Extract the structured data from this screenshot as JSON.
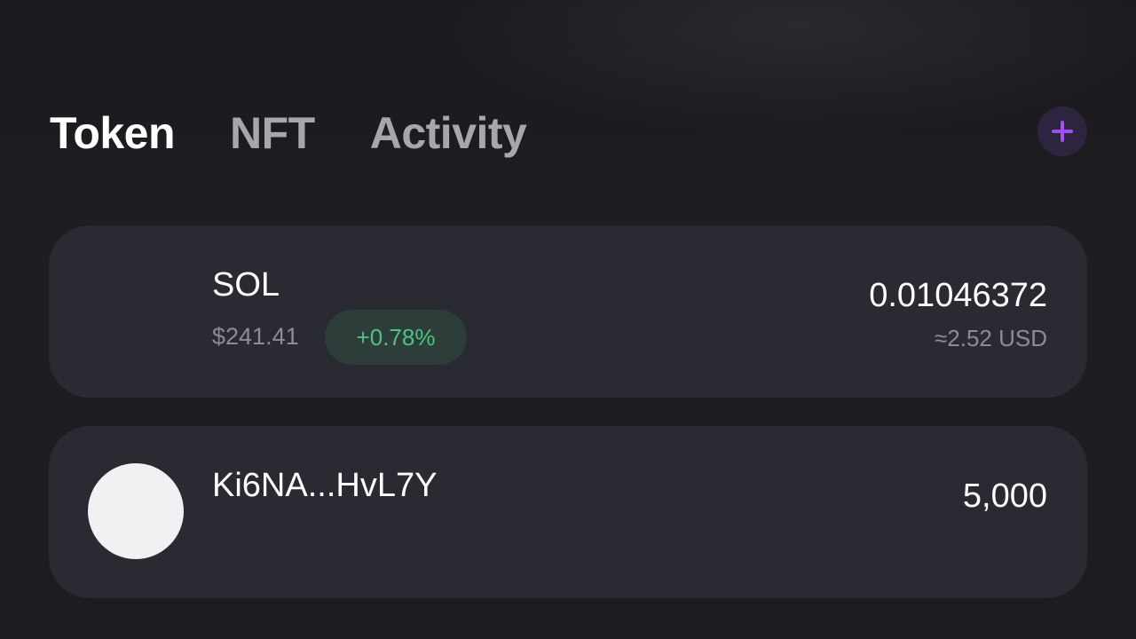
{
  "tabs": [
    {
      "label": "Token",
      "active": true
    },
    {
      "label": "NFT",
      "active": false
    },
    {
      "label": "Activity",
      "active": false
    }
  ],
  "add_button": {
    "icon": "plus-icon",
    "color": "#a24ff0"
  },
  "tokens": [
    {
      "name": "SOL",
      "price": "$241.41",
      "change": "+0.78%",
      "balance": "0.01046372",
      "usd_value": "≈2.52 USD"
    },
    {
      "name": "Ki6NA...HvL7Y",
      "balance": "5,000",
      "icon": "token-avatar-icon"
    }
  ],
  "colors": {
    "background": "#1c1c20",
    "card": "#2a2a33",
    "positive": "#4fc27e",
    "accent": "#a24ff0"
  }
}
